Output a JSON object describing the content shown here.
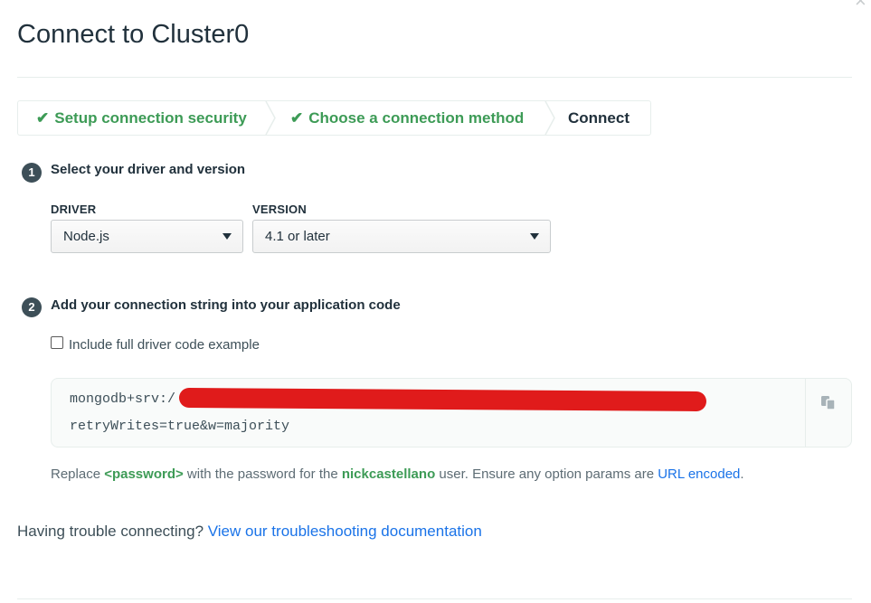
{
  "modal": {
    "title": "Connect to Cluster0",
    "close": "×"
  },
  "breadcrumb": {
    "steps": [
      {
        "label": "Setup connection security",
        "status": "done"
      },
      {
        "label": "Choose a connection method",
        "status": "done"
      },
      {
        "label": "Connect",
        "status": "current"
      }
    ],
    "check_glyph": "✔"
  },
  "step1": {
    "number": "1",
    "title": "Select your driver and version",
    "driver_label": "DRIVER",
    "driver_value": "Node.js",
    "version_label": "VERSION",
    "version_value": "4.1 or later"
  },
  "step2": {
    "number": "2",
    "title": "Add your connection string into your application code",
    "checkbox_label": "Include full driver code example",
    "checkbox_checked": false,
    "code_line1": "mongodb+srv:/",
    "code_line2": "retryWrites=true&w=majority",
    "note_prefix": "Replace ",
    "note_password": "<password>",
    "note_middle": " with the password for the ",
    "note_user": "nickcastellano",
    "note_after_user": " user. Ensure any option params are ",
    "note_link": "URL encoded",
    "note_end": "."
  },
  "footer": {
    "trouble_text": "Having trouble connecting? ",
    "trouble_link": "View our troubleshooting documentation"
  },
  "colors": {
    "success_green": "#3d9b56",
    "link_blue": "#1a73e8",
    "step_badge": "#3d4f58",
    "redaction_red": "#e01b1b"
  }
}
